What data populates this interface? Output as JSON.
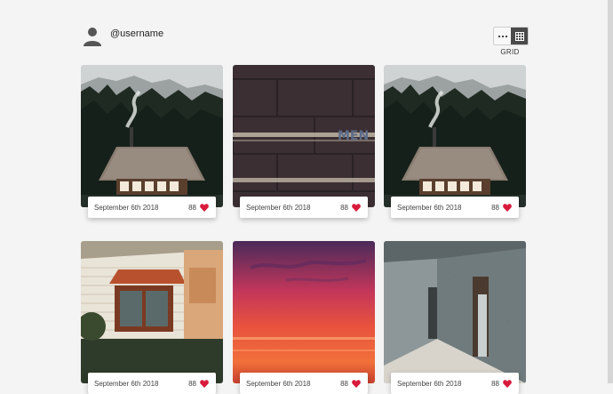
{
  "profile": {
    "username": "@username"
  },
  "view": {
    "label": "GRID",
    "options": [
      "more-options",
      "grid"
    ]
  },
  "posts": [
    {
      "date": "September 6th 2018",
      "likes": "88",
      "photo": "mountain-cabin"
    },
    {
      "date": "September 6th 2018",
      "likes": "88",
      "photo": "brick-wall-men"
    },
    {
      "date": "September 6th 2018",
      "likes": "88",
      "photo": "mountain-cabin"
    },
    {
      "date": "September 6th 2018",
      "likes": "88",
      "photo": "house-window"
    },
    {
      "date": "September 6th 2018",
      "likes": "88",
      "photo": "sunset-sky"
    },
    {
      "date": "September 6th 2018",
      "likes": "88",
      "photo": "concrete-room"
    }
  ],
  "colors": {
    "accent_heart": "#d81b3c",
    "background": "#f4f4f4",
    "toggle_active": "#4a4a4a"
  }
}
